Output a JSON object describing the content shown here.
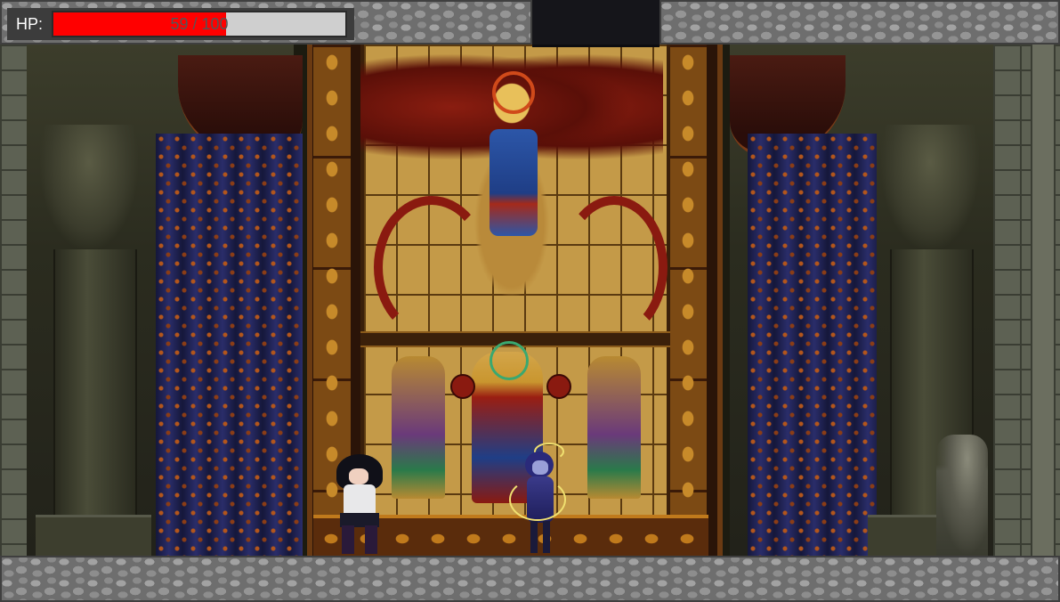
{
  "hud": {
    "hp_label": "HP:",
    "hp_text": "59 / 100",
    "hp_current": 59,
    "hp_max": 100,
    "hp_fill_color": "#ff0000",
    "hp_track_color": "#cfcfcf"
  },
  "scene": {
    "icons": {
      "player": "player-character-icon",
      "enemy": "enemy-character-icon"
    }
  }
}
